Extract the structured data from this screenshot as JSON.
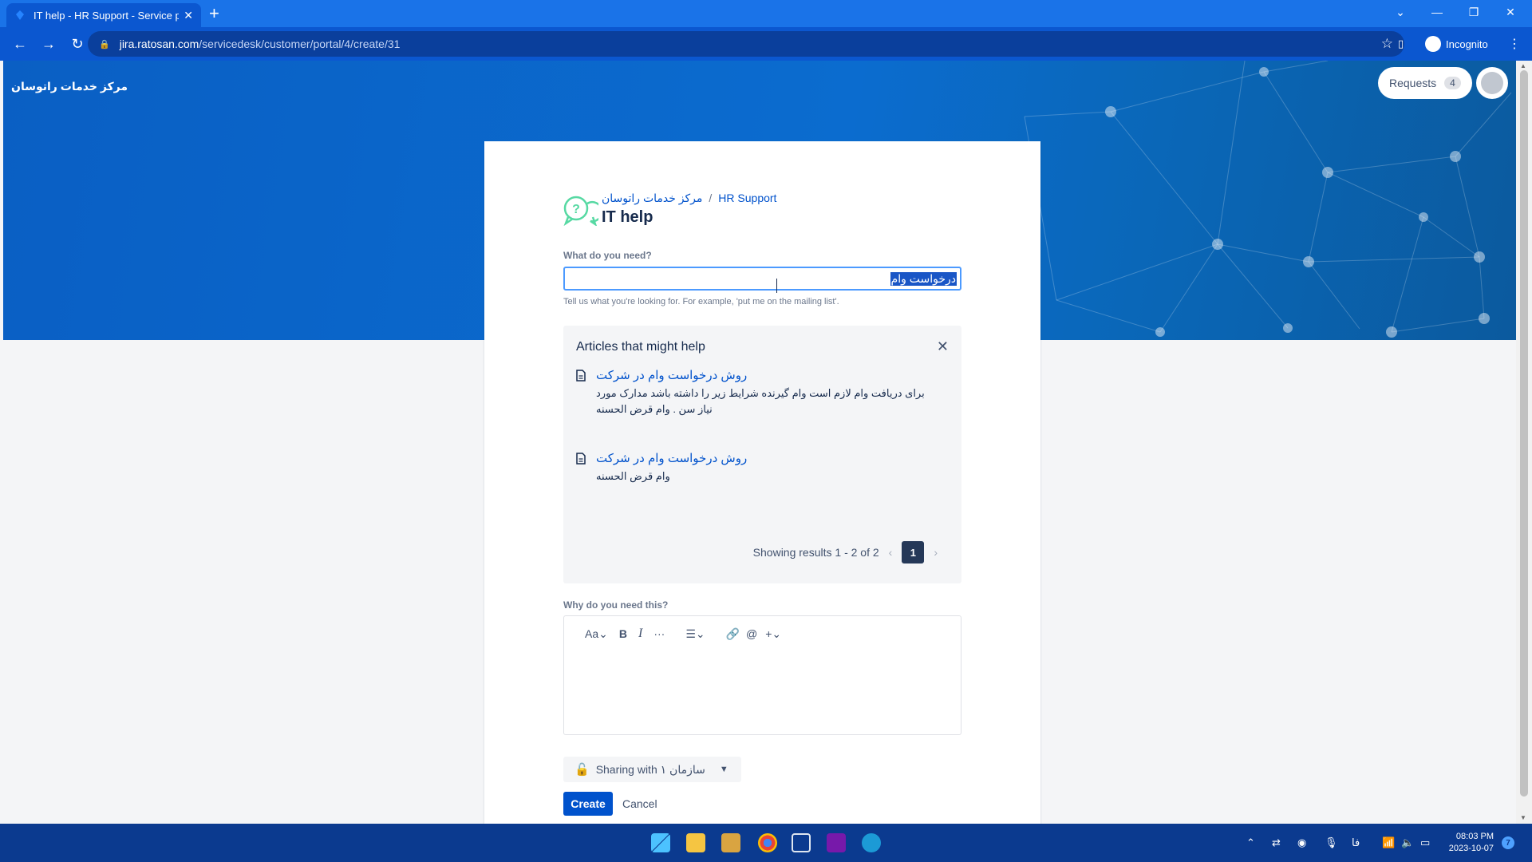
{
  "browser": {
    "tab_title": "IT help - HR Support - Service p",
    "url_host": "jira.ratosan.com",
    "url_path": "/servicedesk/customer/portal/4/create/31",
    "profile_label": "Incognito"
  },
  "header": {
    "help_center_name": "مرکز خدمات راتوسان",
    "requests_label": "Requests",
    "requests_count": "4"
  },
  "form": {
    "breadcrumb": [
      "مرکز خدمات راتوسان",
      "HR Support"
    ],
    "breadcrumb_sep": "/",
    "title": "IT help",
    "summary_label": "What do you need?",
    "summary_value": "درخواست وام",
    "summary_help": "Tell us what you're looking for. For example, 'put me on the mailing list'.",
    "description_label": "Why do you need this?",
    "sharing_prefix": "Sharing with",
    "sharing_org": "سازمان ۱",
    "create_label": "Create",
    "cancel_label": "Cancel"
  },
  "articles": {
    "heading": "Articles that might help",
    "items": [
      {
        "title": "روش درخواست وام در شرکت",
        "excerpt_line1": "برای دریافت وام لازم است وام گیرنده شرایط زیر را داشته باشد مدارک  مورد",
        "excerpt_line2": "نیاز سن . وام قرض الحسنه"
      },
      {
        "title": "روش درخواست وام در شرکت",
        "excerpt_line1": "وام قرض الحسنه"
      }
    ],
    "results_text": "Showing results 1 - 2 of 2",
    "current_page": "1"
  },
  "editor_toolbar": {
    "text_style": "Aa",
    "bold": "B",
    "italic": "I",
    "more": "···"
  },
  "taskbar": {
    "time": "08:03 PM",
    "date": "2023-10-07",
    "lang": "فا",
    "notifications": "7"
  },
  "colors": {
    "brand": "#0052cc",
    "chrome": "#1a73e8",
    "banner": "#0b6ccf"
  }
}
